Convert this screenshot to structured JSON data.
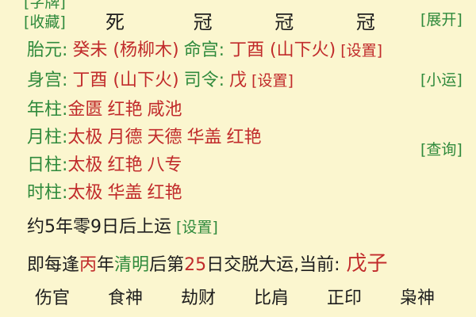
{
  "top": {
    "partial_button": "[字牌]",
    "collect_button": "[收藏]",
    "expand_button": "[展开]",
    "stars": [
      "死",
      "冠",
      "冠",
      "冠"
    ]
  },
  "taiyuan": {
    "label": "胎元:",
    "value": "癸未 (杨柳木)",
    "minggong_label": "命宫:",
    "minggong_value": "丁酉 (山下火)",
    "set_button": "[设置]"
  },
  "shengong": {
    "label": "身宫:",
    "value": "丁酉 (山下火)",
    "siling_label": "司令:",
    "siling_value": "戊",
    "set_button": "[设置]",
    "xiaoyun_button": "[小运]"
  },
  "pillars": [
    {
      "label": "年柱:",
      "values": [
        "金匮",
        "红艳",
        "咸池"
      ]
    },
    {
      "label": "月柱:",
      "values": [
        "太极",
        "月德",
        "天德",
        "华盖",
        "红艳"
      ]
    },
    {
      "label": "日柱:",
      "values": [
        "太极",
        "红艳",
        "八专"
      ]
    },
    {
      "label": "时柱:",
      "values": [
        "太极",
        "华盖",
        "红艳"
      ]
    }
  ],
  "query_button": "[查询]",
  "luck_start": {
    "text": "约5年零9日后上运",
    "set_button": "[设置]"
  },
  "transfer": {
    "p1": "即每逢",
    "p2": "丙",
    "p3": "年",
    "p4": "清明",
    "p5": "后第",
    "p6": "25",
    "p7": "日交脱大运,当前:",
    "current": "戊子"
  },
  "ten_gods": [
    "伤官",
    "食神",
    "劫财",
    "比肩",
    "正印",
    "枭神"
  ],
  "colors": {
    "background": "#fbf6cf",
    "green": "#2f8a3c",
    "red": "#c12b2b",
    "text": "#1d1d1d"
  }
}
